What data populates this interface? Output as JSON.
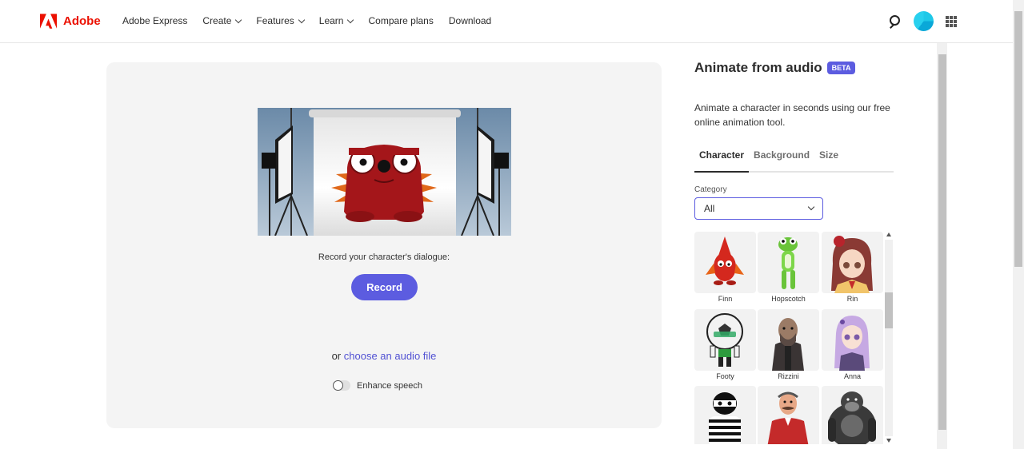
{
  "header": {
    "brand": "Adobe",
    "nav": [
      {
        "label": "Adobe Express",
        "dropdown": false
      },
      {
        "label": "Create",
        "dropdown": true
      },
      {
        "label": "Features",
        "dropdown": true
      },
      {
        "label": "Learn",
        "dropdown": true
      },
      {
        "label": "Compare plans",
        "dropdown": false
      },
      {
        "label": "Download",
        "dropdown": false
      }
    ]
  },
  "stage": {
    "dialogue_label": "Record your character's dialogue:",
    "record_label": "Record",
    "choose_prefix": "or",
    "choose_link": "choose an audio file",
    "enhance_label": "Enhance speech"
  },
  "panel": {
    "title": "Animate from audio",
    "badge": "BETA",
    "description": "Animate a character in seconds using our free online animation tool.",
    "tabs": [
      {
        "label": "Character",
        "active": true
      },
      {
        "label": "Background",
        "active": false
      },
      {
        "label": "Size",
        "active": false
      }
    ],
    "category_label": "Category",
    "category_value": "All",
    "characters": [
      {
        "name": "Finn"
      },
      {
        "name": "Hopscotch"
      },
      {
        "name": "Rin"
      },
      {
        "name": "Footy"
      },
      {
        "name": "Rizzini"
      },
      {
        "name": "Anna"
      },
      {
        "name": ""
      },
      {
        "name": ""
      },
      {
        "name": ""
      }
    ]
  },
  "colors": {
    "accent": "#5c5ce0",
    "adobe_red": "#eb1000"
  }
}
